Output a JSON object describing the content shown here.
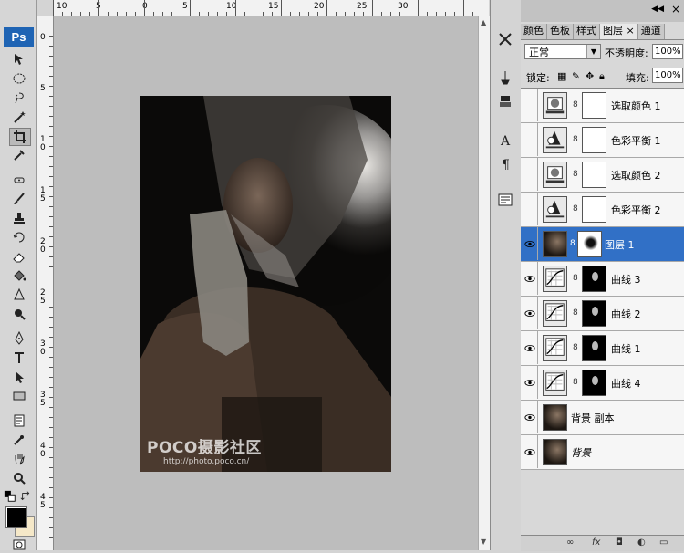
{
  "app": {
    "logo": "Ps"
  },
  "ruler_top_labels": [
    "10",
    "5",
    "0",
    "5",
    "10",
    "15",
    "20",
    "25",
    "30"
  ],
  "ruler_left_labels": [
    "0",
    "5",
    "1 0",
    "1 5",
    "2 0",
    "2 5",
    "3 0",
    "3 5",
    "4 0",
    "4 5"
  ],
  "tools": [
    "move-icon",
    "marquee-icon",
    "lasso-icon",
    "magic-wand-icon",
    "crop-icon",
    "eyedropper-icon",
    "spot-heal-icon",
    "brush-icon",
    "clone-stamp-icon",
    "history-brush-icon",
    "eraser-icon",
    "paint-bucket-icon",
    "blur-icon",
    "dodge-icon",
    "pen-icon",
    "type-icon",
    "path-select-icon",
    "rectangle-icon",
    "notes-icon",
    "eyedropper2-icon",
    "hand-icon",
    "zoom-icon"
  ],
  "colors": {
    "foreground": "#000000",
    "background": "#f5e8c8",
    "selection": "#3170c6"
  },
  "watermark": {
    "logo": "POCO摄影社区",
    "url": "http://photo.poco.cn/"
  },
  "panel": {
    "tabs": [
      "颜色",
      "色板",
      "样式",
      "图层",
      "通道"
    ],
    "active_tab": "图层",
    "close_glyph": "×",
    "blend_mode": "正常",
    "opacity_label": "不透明度:",
    "opacity_value": "100%",
    "lock_label": "锁定:",
    "fill_label": "填充:",
    "fill_value": "100%"
  },
  "layers": [
    {
      "name": "选取颜色 1",
      "visible": false,
      "type": "selective-color"
    },
    {
      "name": "色彩平衡 1",
      "visible": false,
      "type": "color-balance"
    },
    {
      "name": "选取颜色 2",
      "visible": false,
      "type": "selective-color"
    },
    {
      "name": "色彩平衡 2",
      "visible": false,
      "type": "color-balance"
    },
    {
      "name": "图层 1",
      "visible": true,
      "type": "pixel",
      "selected": true
    },
    {
      "name": "曲线 3",
      "visible": true,
      "type": "curves"
    },
    {
      "name": "曲线 2",
      "visible": true,
      "type": "curves"
    },
    {
      "name": "曲线 1",
      "visible": true,
      "type": "curves"
    },
    {
      "name": "曲线 4",
      "visible": true,
      "type": "curves"
    },
    {
      "name": "背景 副本",
      "visible": true,
      "type": "pixel"
    },
    {
      "name": "背景",
      "visible": true,
      "type": "background"
    }
  ]
}
